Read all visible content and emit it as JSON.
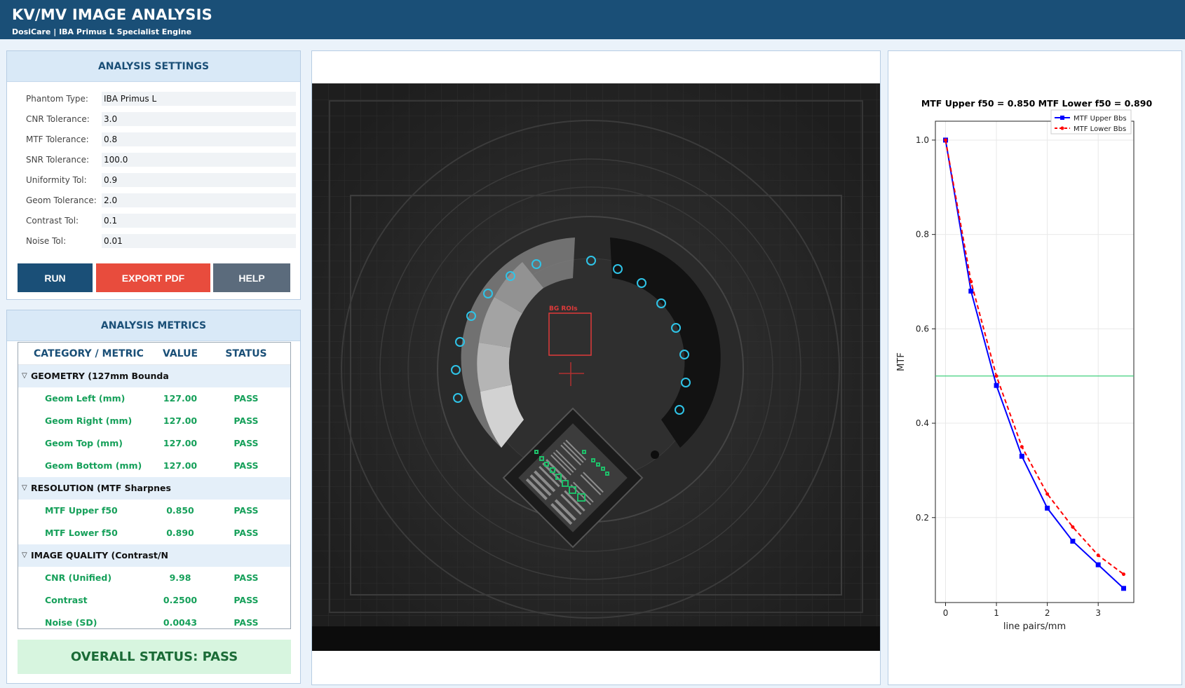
{
  "header": {
    "title": "KV/MV IMAGE ANALYSIS",
    "subtitle": "DosiCare | IBA Primus L Specialist Engine"
  },
  "settings": {
    "title": "ANALYSIS SETTINGS",
    "rows": [
      {
        "label": "Phantom Type:",
        "value": "IBA Primus L"
      },
      {
        "label": "CNR Tolerance:",
        "value": "3.0"
      },
      {
        "label": "MTF Tolerance:",
        "value": "0.8"
      },
      {
        "label": "SNR Tolerance:",
        "value": "100.0"
      },
      {
        "label": "Uniformity Tol:",
        "value": "0.9"
      },
      {
        "label": "Geom Tolerance:",
        "value": "2.0"
      },
      {
        "label": "Contrast Tol:",
        "value": "0.1"
      },
      {
        "label": "Noise Tol:",
        "value": "0.01"
      }
    ],
    "buttons": {
      "run": "RUN",
      "export": "EXPORT PDF",
      "help": "HELP"
    }
  },
  "metrics": {
    "title": "ANALYSIS METRICS",
    "columns": {
      "category": "CATEGORY / METRIC",
      "value": "VALUE",
      "status": "STATUS"
    },
    "groups": [
      {
        "name": "GEOMETRY (127mm Bounda",
        "rows": [
          {
            "name": "Geom Left (mm)",
            "value": "127.00",
            "status": "PASS"
          },
          {
            "name": "Geom Right (mm)",
            "value": "127.00",
            "status": "PASS"
          },
          {
            "name": "Geom Top (mm)",
            "value": "127.00",
            "status": "PASS"
          },
          {
            "name": "Geom Bottom (mm)",
            "value": "127.00",
            "status": "PASS"
          }
        ]
      },
      {
        "name": "RESOLUTION (MTF Sharpnes",
        "rows": [
          {
            "name": "MTF Upper f50",
            "value": "0.850",
            "status": "PASS"
          },
          {
            "name": "MTF Lower f50",
            "value": "0.890",
            "status": "PASS"
          }
        ]
      },
      {
        "name": "IMAGE QUALITY (Contrast/N",
        "rows": [
          {
            "name": "CNR (Unified)",
            "value": "9.98",
            "status": "PASS"
          },
          {
            "name": "Contrast",
            "value": "0.2500",
            "status": "PASS"
          },
          {
            "name": "Noise (SD)",
            "value": "0.0043",
            "status": "PASS"
          }
        ]
      }
    ],
    "overall": "OVERALL STATUS: PASS"
  },
  "image": {
    "roi_label": "BG ROIs"
  },
  "colors": {
    "header_bg": "#1a4f77",
    "pass_green": "#16a05a",
    "export_red": "#e84c3d",
    "roi_cyan": "#2fc4e8",
    "upper_series": "#0000ff",
    "lower_series": "#ff0000",
    "threshold_line": "#2ecc71"
  },
  "chart_data": {
    "type": "line",
    "title": "MTF Upper f50 = 0.850  MTF Lower f50 = 0.890",
    "xlabel": "line pairs/mm",
    "ylabel": "MTF",
    "xlim": [
      -0.2,
      3.7
    ],
    "ylim": [
      0.02,
      1.04
    ],
    "xticks": [
      0,
      1,
      2,
      3
    ],
    "yticks": [
      0.2,
      0.4,
      0.6,
      0.8,
      1.0
    ],
    "grid": true,
    "legend_position": "top-right",
    "threshold": 0.5,
    "series": [
      {
        "name": "MTF Upper Bbs",
        "x": [
          0,
          0.5,
          1.0,
          1.5,
          2.0,
          2.5,
          3.0,
          3.5
        ],
        "y": [
          1.0,
          0.68,
          0.48,
          0.33,
          0.22,
          0.15,
          0.1,
          0.05
        ]
      },
      {
        "name": "MTF Lower Bbs",
        "x": [
          0,
          0.5,
          1.0,
          1.5,
          2.0,
          2.5,
          3.0,
          3.5
        ],
        "y": [
          1.0,
          0.7,
          0.5,
          0.35,
          0.25,
          0.18,
          0.12,
          0.08
        ]
      }
    ]
  }
}
